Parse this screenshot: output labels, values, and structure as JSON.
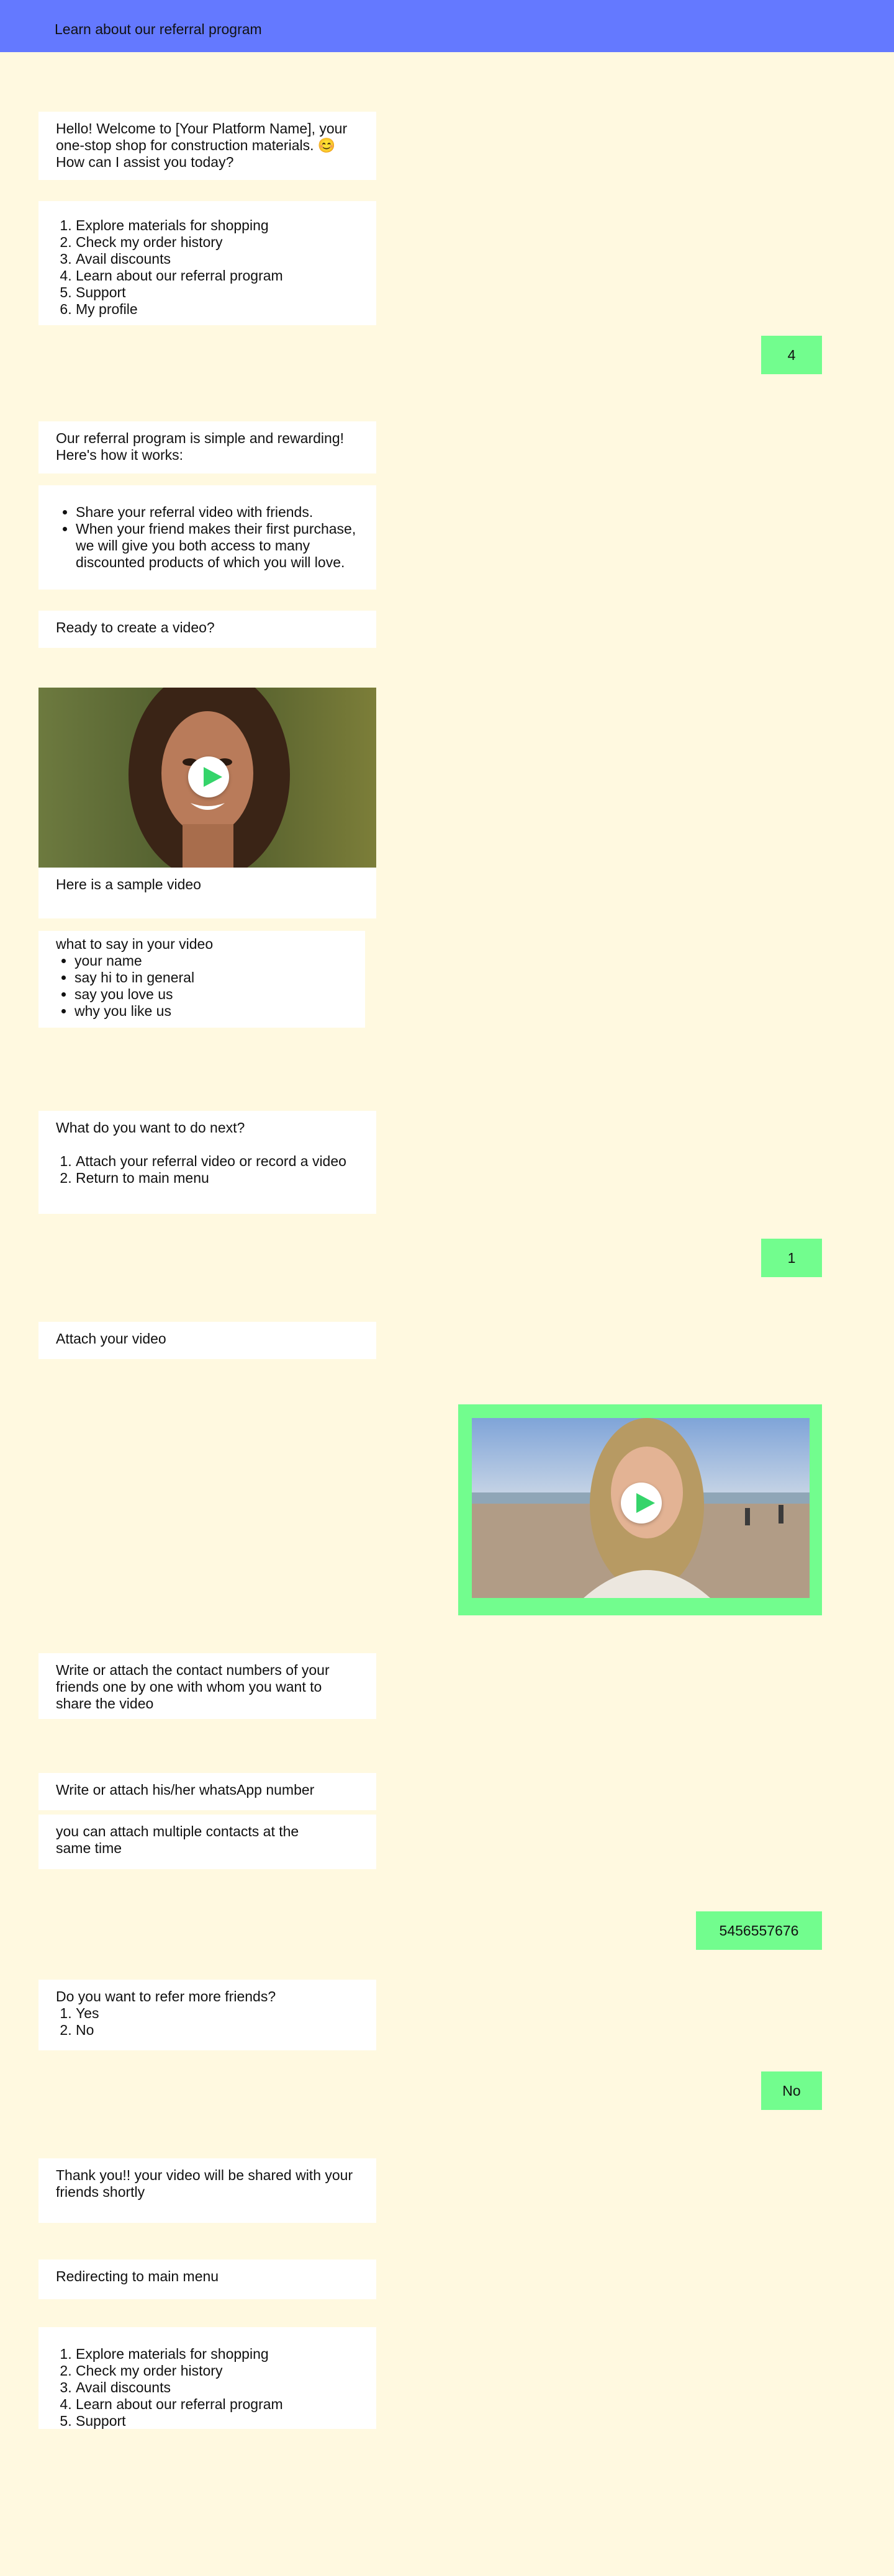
{
  "header": {
    "title": "Learn about our referral program"
  },
  "messages": {
    "welcome": "Hello! Welcome to [Your Platform Name], your one-stop shop for construction materials. 😊 How can I assist you today?",
    "main_menu": [
      "Explore materials for shopping",
      "Check my order history",
      "Avail discounts",
      "Learn about our referral program",
      "Support",
      "My profile"
    ],
    "reply_menu_choice": "4",
    "referral_intro": "Our referral program is simple and rewarding! Here's how it works:",
    "referral_steps": [
      "Share your referral video with friends.",
      "When your friend makes their first purchase, we will give you both access to many discounted products of which you will love."
    ],
    "ready_prompt": "Ready to create a video?",
    "sample_video_caption": "Here is a sample video",
    "tips_title": "what to say in your video",
    "tips": [
      "your name",
      "say hi to in general",
      "say you love us",
      "why you like us"
    ],
    "next_prompt": "What do you want to do next?",
    "next_options": [
      "Attach your referral video or record a video",
      "Return to main menu"
    ],
    "reply_next_choice": "1",
    "attach_prompt": "Attach your video",
    "contacts_prompt": "Write or attach the contact numbers of your friends one by one with whom you want to share the video",
    "whatsapp_prompt": "Write or attach his/her whatsApp number",
    "multiple_hint": "you can attach multiple contacts at the same time",
    "reply_phone": "5456557676",
    "refer_more_prompt": "Do you want to refer more friends?",
    "refer_more_options": [
      "Yes",
      "No"
    ],
    "reply_refer_more": "No",
    "thanks": "Thank you!! your video will be shared with your friends shortly",
    "redirecting": "Redirecting to main menu",
    "main_menu_repeat": [
      "Explore materials for shopping",
      "Check my order history",
      "Avail discounts",
      "Learn about our referral program",
      "Support"
    ]
  },
  "colors": {
    "header": "#6479ff",
    "background": "#fff9e0",
    "user_reply": "#72fd8e",
    "bot_bubble": "#ffffff",
    "play_icon": "#35d46a"
  }
}
